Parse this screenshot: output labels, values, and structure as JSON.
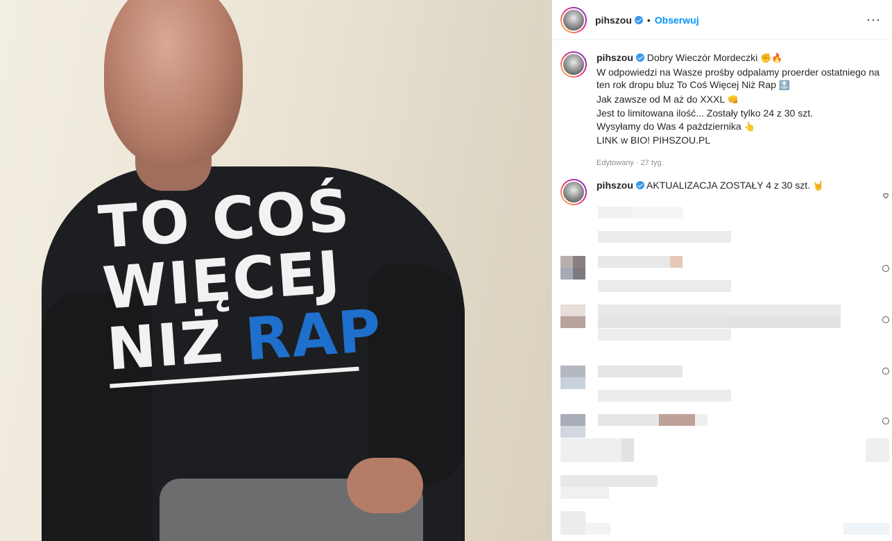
{
  "post": {
    "author": "pihszou",
    "follow_label": "Obserwuj",
    "dot": "•",
    "more_label": "···"
  },
  "caption": {
    "author": "pihszou",
    "lines": [
      "Dobry Wieczór Mordeczki",
      "W odpowiedzi na Wasze prośby odpalamy proerder ostatniego na ten rok dropu bluz To Coś Więcej Niż Rap",
      "Jak zawsze od M aż do XXXL",
      "Jest to limitowana ilość... Zostały tylko 24 z 30 szt.",
      "Wysyłamy do Was 4 października",
      "LINK w BIO! PIHSZOU.PL"
    ],
    "emojis": {
      "line1": "✊🔥",
      "line2": "🔝",
      "line3": "👊",
      "line5": "👆"
    },
    "meta": "Edytowany · 27 tyg."
  },
  "comment": {
    "author": "pihszou",
    "text": "AKTUALIZACJA ZOSTAŁY 4 z 30 szt.",
    "emoji": "🤘"
  },
  "shirt_print": {
    "line1": "TO COŚ",
    "line2": "WIĘCEJ",
    "line3a": "NIŻ",
    "line3b": "RAP"
  },
  "colors": {
    "accent": "#0095f6",
    "verified": "#3897f0",
    "meta": "#8e8e8e"
  }
}
